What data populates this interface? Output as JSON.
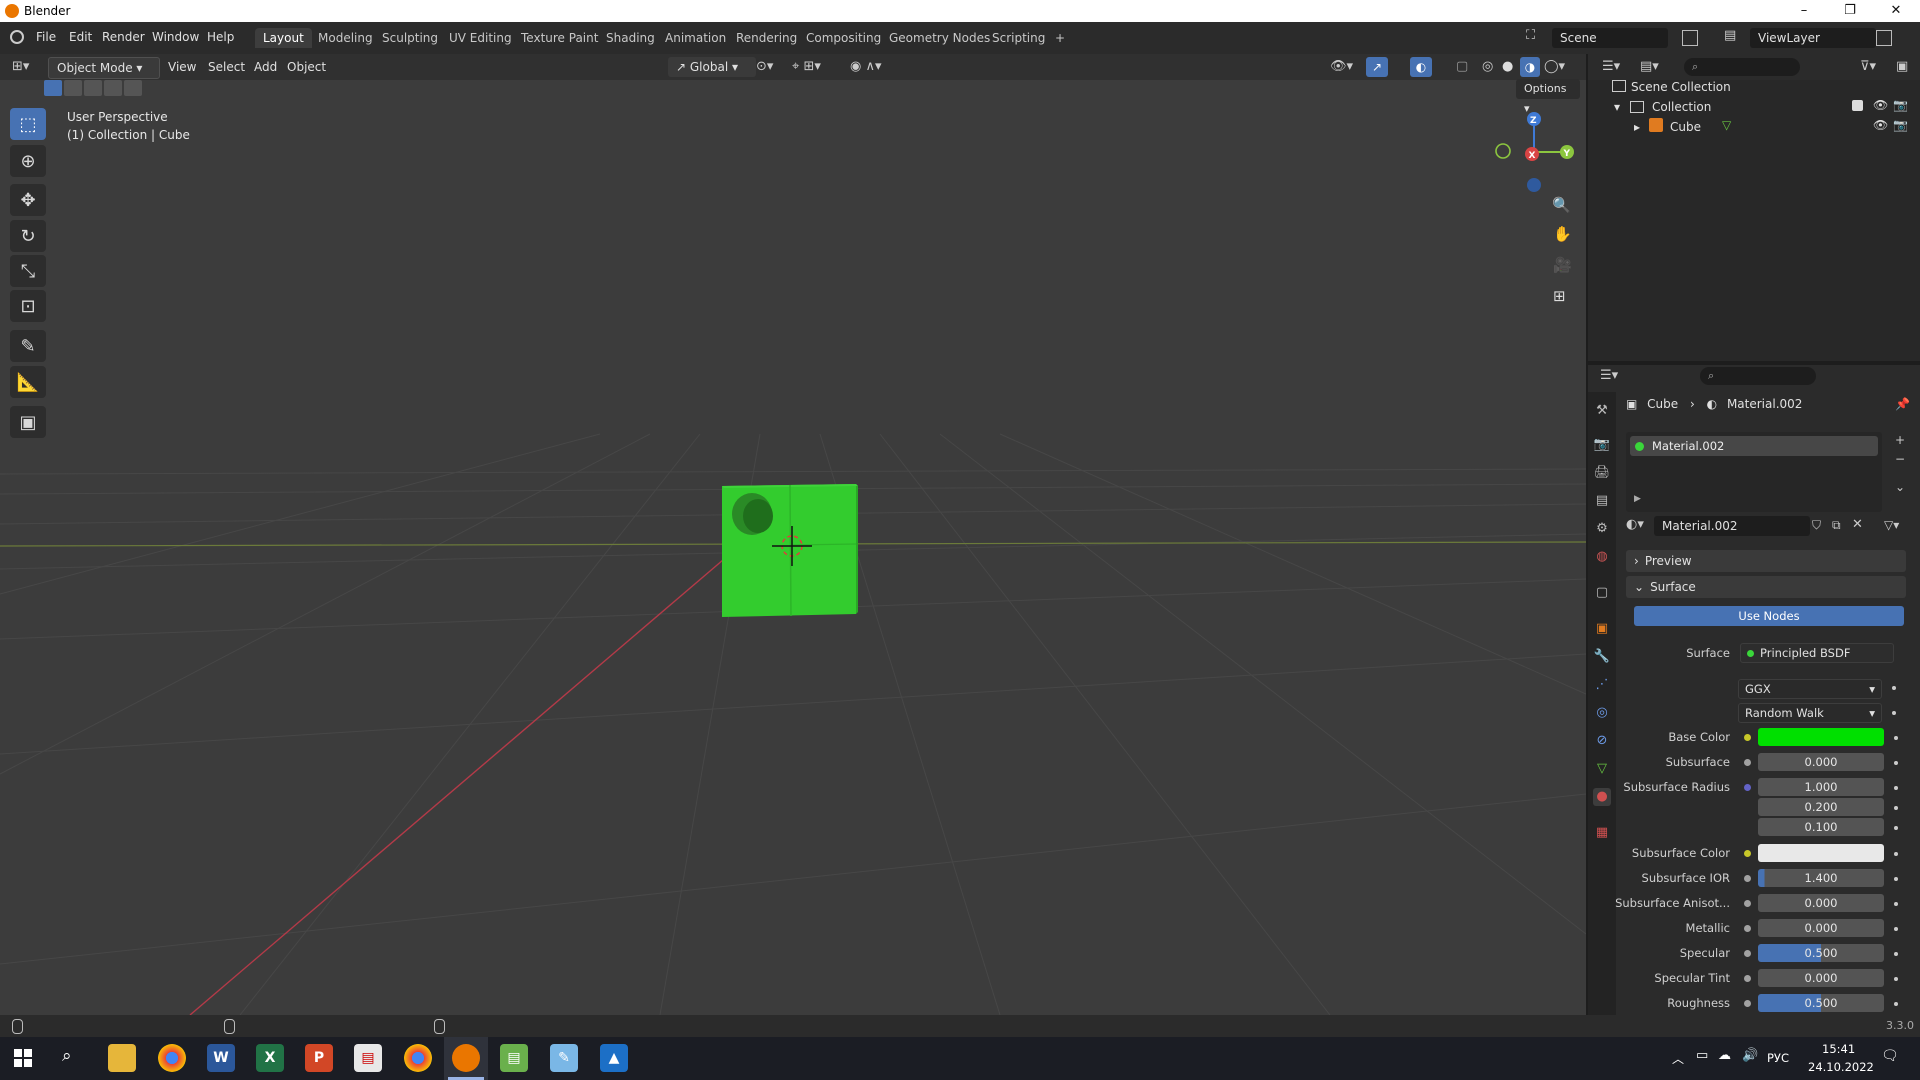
{
  "window": {
    "title": "Blender",
    "min": "–",
    "max": "❐",
    "close": "✕"
  },
  "menus": [
    "File",
    "Edit",
    "Render",
    "Window",
    "Help"
  ],
  "workspaces": [
    "Layout",
    "Modeling",
    "Sculpting",
    "UV Editing",
    "Texture Paint",
    "Shading",
    "Animation",
    "Rendering",
    "Compositing",
    "Geometry Nodes",
    "Scripting",
    "+"
  ],
  "active_workspace": "Layout",
  "scene": {
    "name": "Scene",
    "view_layer": "ViewLayer"
  },
  "viewport_header": {
    "mode": "Object Mode",
    "menus": [
      "View",
      "Select",
      "Add",
      "Object"
    ],
    "orientation": "Global",
    "options": "Options"
  },
  "viewport": {
    "info_line1": "User Perspective",
    "info_line2": "(1) Collection | Cube",
    "gizmo": {
      "x": "X",
      "y": "Y",
      "z": "Z"
    }
  },
  "outliner": {
    "scene_collection": "Scene Collection",
    "collection": "Collection",
    "cube": "Cube"
  },
  "properties": {
    "breadcrumb_object": "Cube",
    "breadcrumb_material": "Material.002",
    "slot_name": "Material.002",
    "material_name": "Material.002",
    "panel_preview": "Preview",
    "panel_surface": "Surface",
    "use_nodes": "Use Nodes",
    "surface_label": "Surface",
    "surface_value": "Principled BSDF",
    "distribution": "GGX",
    "subsurface_method": "Random Walk",
    "rows": [
      {
        "label": "Base Color",
        "value": "",
        "kind": "color",
        "color": "#00e000"
      },
      {
        "label": "Subsurface",
        "value": "0.000",
        "kind": "num",
        "fill": 0
      },
      {
        "label": "Subsurface Radius",
        "value": "1.000",
        "kind": "num",
        "fill": 0
      },
      {
        "label": "",
        "value": "0.200",
        "kind": "num",
        "fill": 0
      },
      {
        "label": "",
        "value": "0.100",
        "kind": "num",
        "fill": 0
      },
      {
        "label": "Subsurface Color",
        "value": "",
        "kind": "color",
        "color": "#e8e8e8"
      },
      {
        "label": "Subsurface IOR",
        "value": "1.400",
        "kind": "num",
        "fill": 0.05
      },
      {
        "label": "Subsurface Anisot...",
        "value": "0.000",
        "kind": "num",
        "fill": 0
      },
      {
        "label": "Metallic",
        "value": "0.000",
        "kind": "num",
        "fill": 0
      },
      {
        "label": "Specular",
        "value": "0.500",
        "kind": "num",
        "fill": 0.5
      },
      {
        "label": "Specular Tint",
        "value": "0.000",
        "kind": "num",
        "fill": 0
      },
      {
        "label": "Roughness",
        "value": "0.500",
        "kind": "num",
        "fill": 0.5
      }
    ]
  },
  "statusbar": {
    "version": "3.3.0"
  },
  "taskbar": {
    "lang": "РУС",
    "time": "15:41",
    "date": "24.10.2022"
  },
  "colors": {
    "accent": "#4772b3",
    "cube": "#33cc33",
    "x_axis": "#d94444",
    "y_axis": "#8cc63f",
    "z_axis": "#3f7ad6"
  }
}
